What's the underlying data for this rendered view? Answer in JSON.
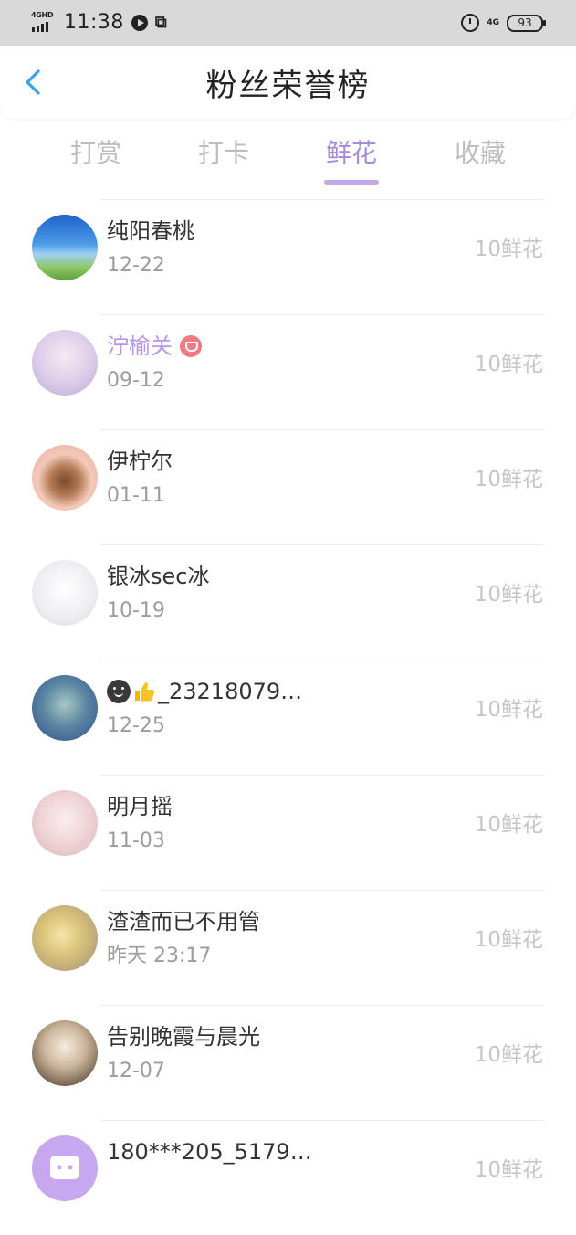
{
  "status_bar": {
    "network": "4GHD",
    "time": "11:38",
    "right_network": "4G",
    "battery": "93"
  },
  "header": {
    "title": "粉丝荣誉榜",
    "back_icon": "chevron-left-icon"
  },
  "tabs": [
    {
      "label": "打赏",
      "active": false
    },
    {
      "label": "打卡",
      "active": false
    },
    {
      "label": "鲜花",
      "active": true
    },
    {
      "label": "收藏",
      "active": false
    }
  ],
  "fans": [
    {
      "name": "纯阳春桃",
      "date": "12-22",
      "amount": "10鲜花"
    },
    {
      "name": "泞榆关",
      "date": "09-12",
      "amount": "10鲜花",
      "badge": "vip-diamond-icon"
    },
    {
      "name": "伊柠尔",
      "date": "01-11",
      "amount": "10鲜花"
    },
    {
      "name": "银冰sec冰",
      "date": "10-19",
      "amount": "10鲜花"
    },
    {
      "name": "_23218079…",
      "date": "12-25",
      "amount": "10鲜花",
      "emoji": [
        "smile-icon",
        "thumbs-up-icon"
      ]
    },
    {
      "name": "明月摇",
      "date": "11-03",
      "amount": "10鲜花"
    },
    {
      "name": "渣渣而已不用管",
      "date": "昨天 23:17",
      "amount": "10鲜花"
    },
    {
      "name": "告别晚霞与晨光",
      "date": "12-07",
      "amount": "10鲜花"
    },
    {
      "name": "180***205_5179…",
      "date": "",
      "amount": "10鲜花"
    }
  ],
  "colors": {
    "accent": "#a78ae0",
    "back_icon": "#3aa0e8",
    "vip_name": "#b895e6",
    "vip_badge": "#f07b85"
  }
}
